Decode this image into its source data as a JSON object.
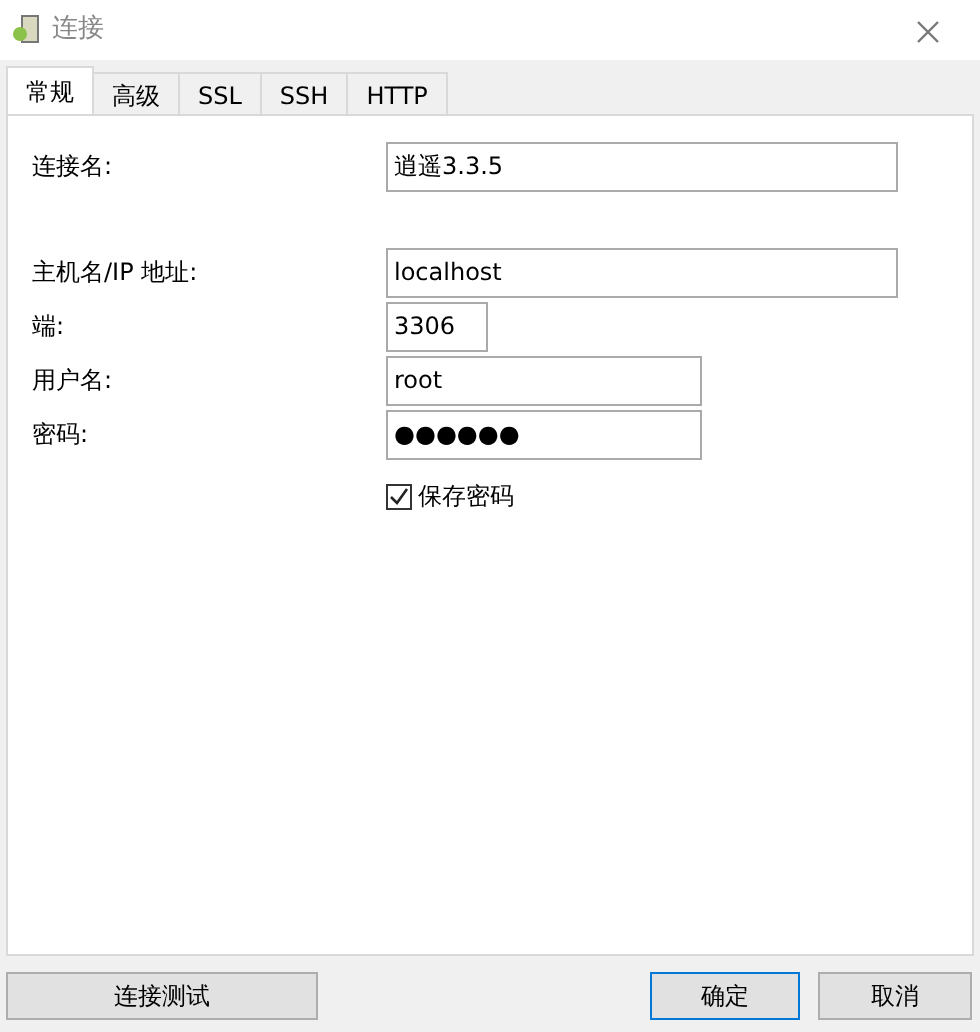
{
  "window": {
    "title": "连接"
  },
  "tabs": [
    {
      "label": "常规",
      "selected": true
    },
    {
      "label": "高级",
      "selected": false
    },
    {
      "label": "SSL",
      "selected": false
    },
    {
      "label": "SSH",
      "selected": false
    },
    {
      "label": "HTTP",
      "selected": false
    }
  ],
  "connection_fields": [
    {
      "label": "连接名:",
      "value": "逍遥3.3.5"
    }
  ],
  "server_fields": [
    {
      "label": "主机名/IP 地址:",
      "value": "localhost"
    },
    {
      "label": "端:",
      "value": "3306"
    },
    {
      "label": "用户名:",
      "value": "root"
    },
    {
      "label": "密码:",
      "value": "●●●●●●"
    }
  ],
  "save_password": {
    "label": "保存密码",
    "checked": true
  },
  "buttons": {
    "test": "连接测试",
    "ok": "确定",
    "cancel": "取消"
  }
}
